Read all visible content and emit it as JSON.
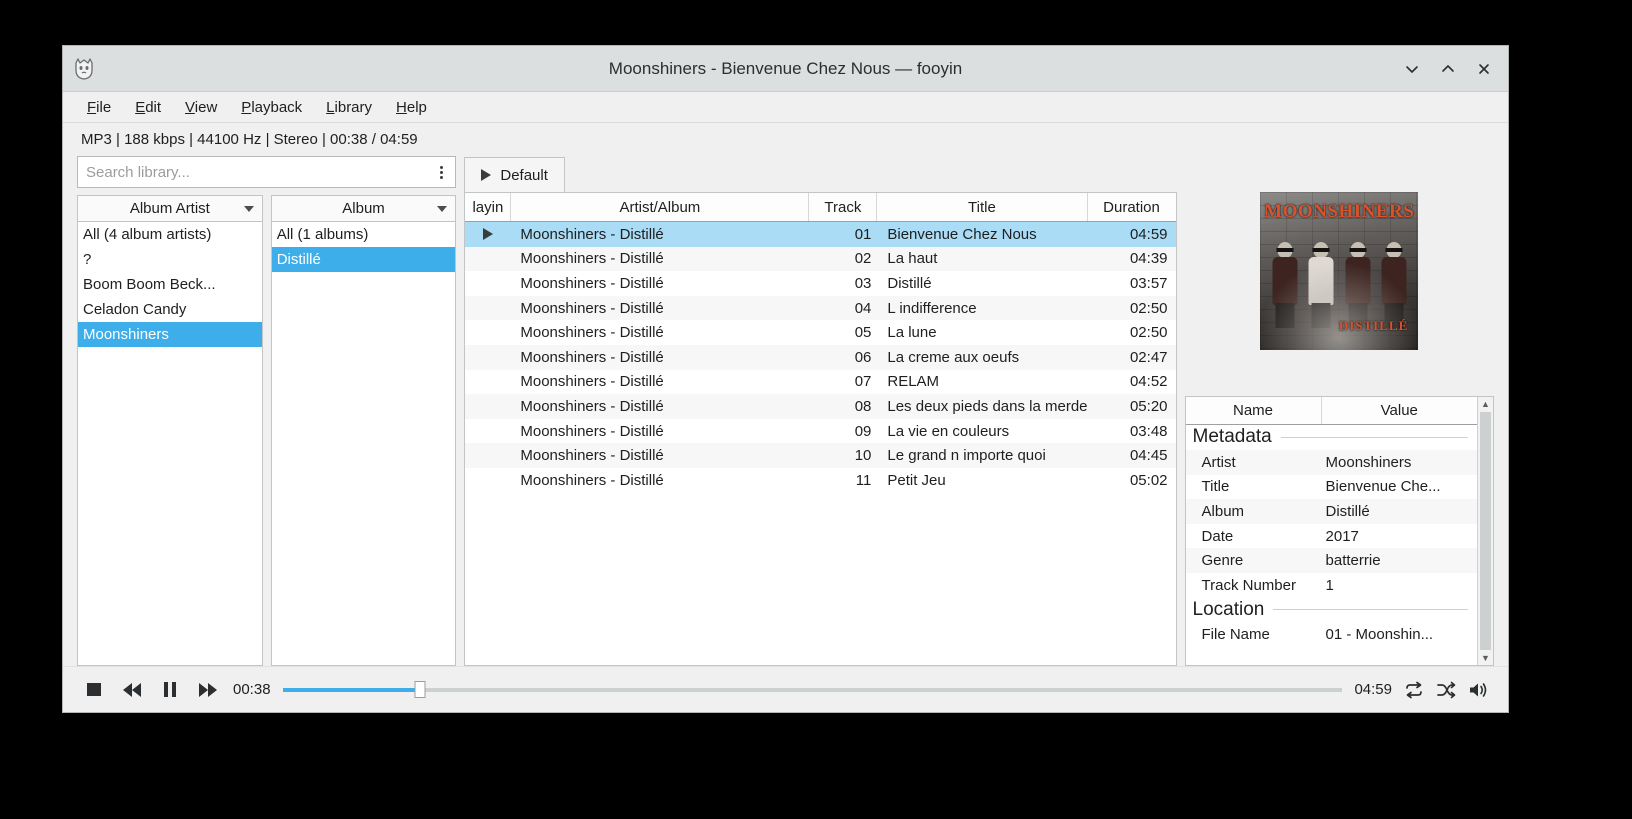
{
  "window": {
    "title": "Moonshiners - Bienvenue Chez Nous — fooyin",
    "logo_icon": "fooyin-wolf-logo-icon",
    "controls": {
      "minimize": "⌄",
      "maximize": "⌃",
      "close": "✕"
    }
  },
  "menubar": {
    "items": [
      {
        "label": "File",
        "mnemonic": "F"
      },
      {
        "label": "Edit",
        "mnemonic": "E"
      },
      {
        "label": "View",
        "mnemonic": "V"
      },
      {
        "label": "Playback",
        "mnemonic": "P"
      },
      {
        "label": "Library",
        "mnemonic": "L"
      },
      {
        "label": "Help",
        "mnemonic": "H"
      }
    ]
  },
  "status": {
    "text": "MP3 | 188 kbps | 44100 Hz | Stereo | 00:38 / 04:59",
    "codec": "MP3",
    "bitrate": "188 kbps",
    "samplerate": "44100 Hz",
    "channels": "Stereo",
    "position": "00:38",
    "duration": "04:59"
  },
  "search": {
    "value": "",
    "placeholder": "Search library...",
    "menu_icon": "overflow-menu-icon"
  },
  "library": {
    "album_artist": {
      "header": "Album Artist",
      "items": [
        {
          "label": "All (4 album artists)",
          "selected": false
        },
        {
          "label": "?",
          "selected": false
        },
        {
          "label": "Boom Boom Beck...",
          "selected": false
        },
        {
          "label": "Celadon Candy",
          "selected": false
        },
        {
          "label": "Moonshiners",
          "selected": true
        }
      ]
    },
    "album": {
      "header": "Album",
      "items": [
        {
          "label": "All (1 albums)",
          "selected": false
        },
        {
          "label": "Distillé",
          "selected": true
        }
      ]
    }
  },
  "playlist": {
    "tabs": [
      {
        "label": "Default",
        "active": true,
        "icon": "play-triangle-icon"
      }
    ],
    "columns": [
      "layin",
      "Artist/Album",
      "Track",
      "Title",
      "Duration"
    ],
    "rows": [
      {
        "playing": true,
        "artist": "Moonshiners - Distillé",
        "track": "01",
        "title": "Bienvenue Chez Nous",
        "duration": "04:59",
        "selected": true
      },
      {
        "playing": false,
        "artist": "Moonshiners - Distillé",
        "track": "02",
        "title": "La haut",
        "duration": "04:39",
        "selected": false
      },
      {
        "playing": false,
        "artist": "Moonshiners - Distillé",
        "track": "03",
        "title": "Distillé",
        "duration": "03:57",
        "selected": false
      },
      {
        "playing": false,
        "artist": "Moonshiners - Distillé",
        "track": "04",
        "title": "L indifference",
        "duration": "02:50",
        "selected": false
      },
      {
        "playing": false,
        "artist": "Moonshiners - Distillé",
        "track": "05",
        "title": "La lune",
        "duration": "02:50",
        "selected": false
      },
      {
        "playing": false,
        "artist": "Moonshiners - Distillé",
        "track": "06",
        "title": "La creme aux oeufs",
        "duration": "02:47",
        "selected": false
      },
      {
        "playing": false,
        "artist": "Moonshiners - Distillé",
        "track": "07",
        "title": "RELAM",
        "duration": "04:52",
        "selected": false
      },
      {
        "playing": false,
        "artist": "Moonshiners - Distillé",
        "track": "08",
        "title": "Les deux pieds dans la merde",
        "duration": "05:20",
        "selected": false
      },
      {
        "playing": false,
        "artist": "Moonshiners - Distillé",
        "track": "09",
        "title": "La vie en couleurs",
        "duration": "03:48",
        "selected": false
      },
      {
        "playing": false,
        "artist": "Moonshiners - Distillé",
        "track": "10",
        "title": "Le grand n importe quoi",
        "duration": "04:45",
        "selected": false
      },
      {
        "playing": false,
        "artist": "Moonshiners - Distillé",
        "track": "11",
        "title": "Petit Jeu",
        "duration": "05:02",
        "selected": false
      }
    ]
  },
  "album_art": {
    "title": "MOONSHINERS",
    "subtitle": "DISTILLÉ"
  },
  "metadata": {
    "columns": [
      "Name",
      "Value"
    ],
    "sections": [
      {
        "title": "Metadata",
        "rows": [
          {
            "name": "Artist",
            "value": "Moonshiners"
          },
          {
            "name": "Title",
            "value": "Bienvenue Che..."
          },
          {
            "name": "Album",
            "value": "Distillé"
          },
          {
            "name": "Date",
            "value": "2017"
          },
          {
            "name": "Genre",
            "value": "batterrie"
          },
          {
            "name": "Track Number",
            "value": "1"
          }
        ]
      },
      {
        "title": "Location",
        "rows": [
          {
            "name": "File Name",
            "value": "01 - Moonshin..."
          }
        ]
      }
    ]
  },
  "player": {
    "stop_label": "Stop",
    "previous_label": "Previous",
    "pause_label": "Pause",
    "next_label": "Next",
    "elapsed": "00:38",
    "total": "04:59",
    "progress_percent": 13,
    "repeat_icon": "↪",
    "shuffle_icon": "⇄",
    "volume_icon": "🔊"
  },
  "colors": {
    "accent": "#3daee9",
    "selection_soft": "#aadcf5",
    "window_bg": "#f0f0f0",
    "titlebar_bg": "#dcdfe0"
  }
}
